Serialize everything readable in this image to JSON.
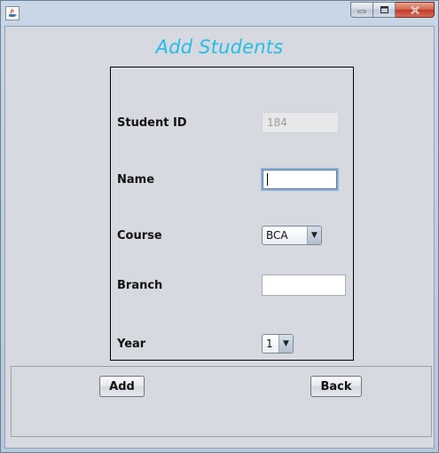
{
  "window": {
    "app_icon": "java-icon",
    "controls": {
      "minimize": "minimize-icon",
      "maximize": "maximize-icon",
      "close": "close-icon"
    }
  },
  "form": {
    "title": "Add Students",
    "title_color": "#22bde8",
    "student_id": {
      "label": "Student ID",
      "value": "184"
    },
    "name": {
      "label": "Name",
      "value": ""
    },
    "course": {
      "label": "Course",
      "selected": "BCA"
    },
    "branch": {
      "label": "Branch",
      "value": ""
    },
    "year": {
      "label": "Year",
      "selected": "1"
    }
  },
  "buttons": {
    "add": "Add",
    "back": "Back"
  }
}
